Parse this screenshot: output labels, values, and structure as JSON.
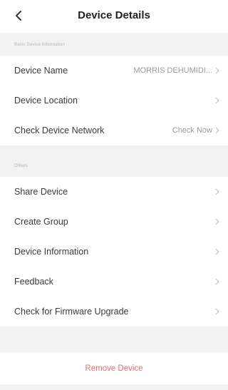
{
  "header": {
    "title": "Device Details"
  },
  "section_basic": {
    "label": "Basic Device Information"
  },
  "basic_rows": [
    {
      "label": "Device Name",
      "value": "MORRIS DEHUMIDI..."
    },
    {
      "label": "Device Location",
      "value": ""
    },
    {
      "label": "Check Device Network",
      "value": "Check Now"
    }
  ],
  "section_others": {
    "label": "Others"
  },
  "other_rows": [
    {
      "label": "Share Device"
    },
    {
      "label": "Create Group"
    },
    {
      "label": "Device Information"
    },
    {
      "label": "Feedback"
    },
    {
      "label": "Check for Firmware Upgrade"
    }
  ],
  "remove": {
    "label": "Remove Device"
  },
  "colors": {
    "background": "#f2f2f2",
    "danger": "#f06a6a",
    "muted": "#9a9a9a"
  },
  "icons": {
    "back": "back-chevron-icon",
    "row_arrow": "chevron-right-icon"
  }
}
